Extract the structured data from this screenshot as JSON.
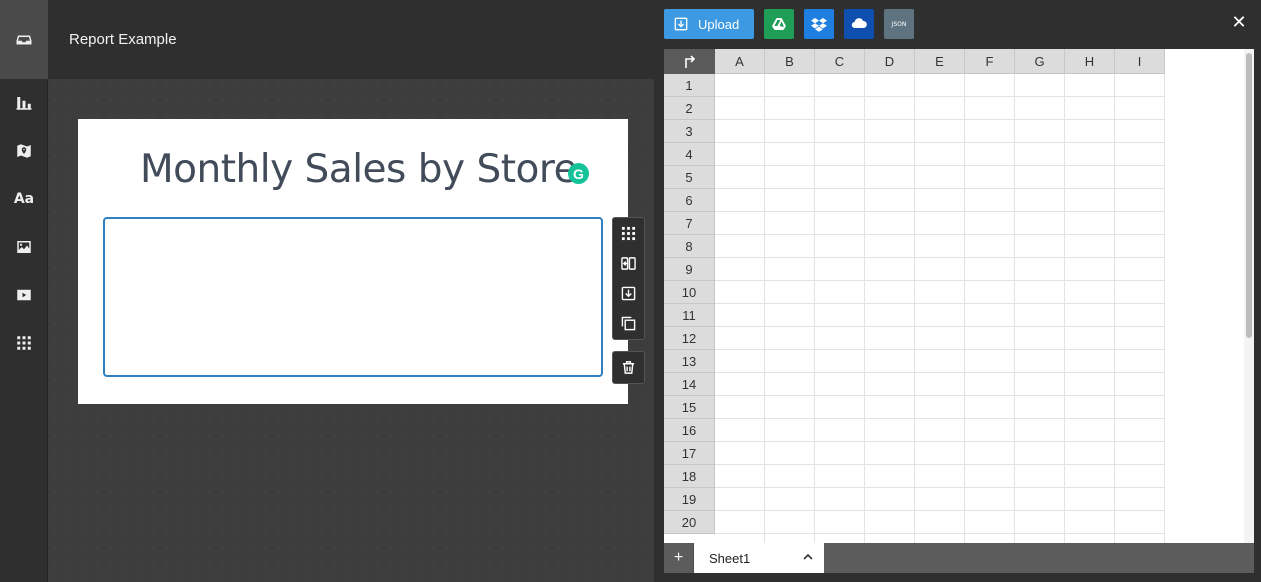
{
  "header": {
    "title": "Report Example"
  },
  "rail": {
    "items": [
      {
        "icon": "inbox-icon"
      },
      {
        "icon": "bar-chart-icon"
      },
      {
        "icon": "map-pin-icon"
      },
      {
        "icon": "text-icon",
        "text": "Aa"
      },
      {
        "icon": "image-icon"
      },
      {
        "icon": "video-icon"
      },
      {
        "icon": "grid-icon"
      }
    ]
  },
  "report": {
    "title": "Monthly Sales by Store",
    "grammar_badge": "G"
  },
  "panel": {
    "upload_label": "Upload",
    "sources": [
      {
        "name": "google-drive-icon",
        "color": "#1e9e57"
      },
      {
        "name": "dropbox-icon",
        "color": "#1f7fe0"
      },
      {
        "name": "onedrive-icon",
        "color": "#0f4fb0"
      },
      {
        "name": "json-icon",
        "label": "JSON",
        "color": "#5e7380"
      }
    ],
    "close_glyph": "✕",
    "add_sheet_glyph": "+",
    "sheet_tab": "Sheet1"
  },
  "spreadsheet": {
    "columns": [
      "A",
      "B",
      "C",
      "D",
      "E",
      "F",
      "G",
      "H",
      "I"
    ],
    "rows": [
      "1",
      "2",
      "3",
      "4",
      "5",
      "6",
      "7",
      "8",
      "9",
      "10",
      "11",
      "12",
      "13",
      "14",
      "15",
      "16",
      "17",
      "18",
      "19",
      "20"
    ]
  },
  "colors": {
    "accent": "#3d9ae2",
    "selection": "#2f7fc1",
    "title": "#424b5a"
  }
}
